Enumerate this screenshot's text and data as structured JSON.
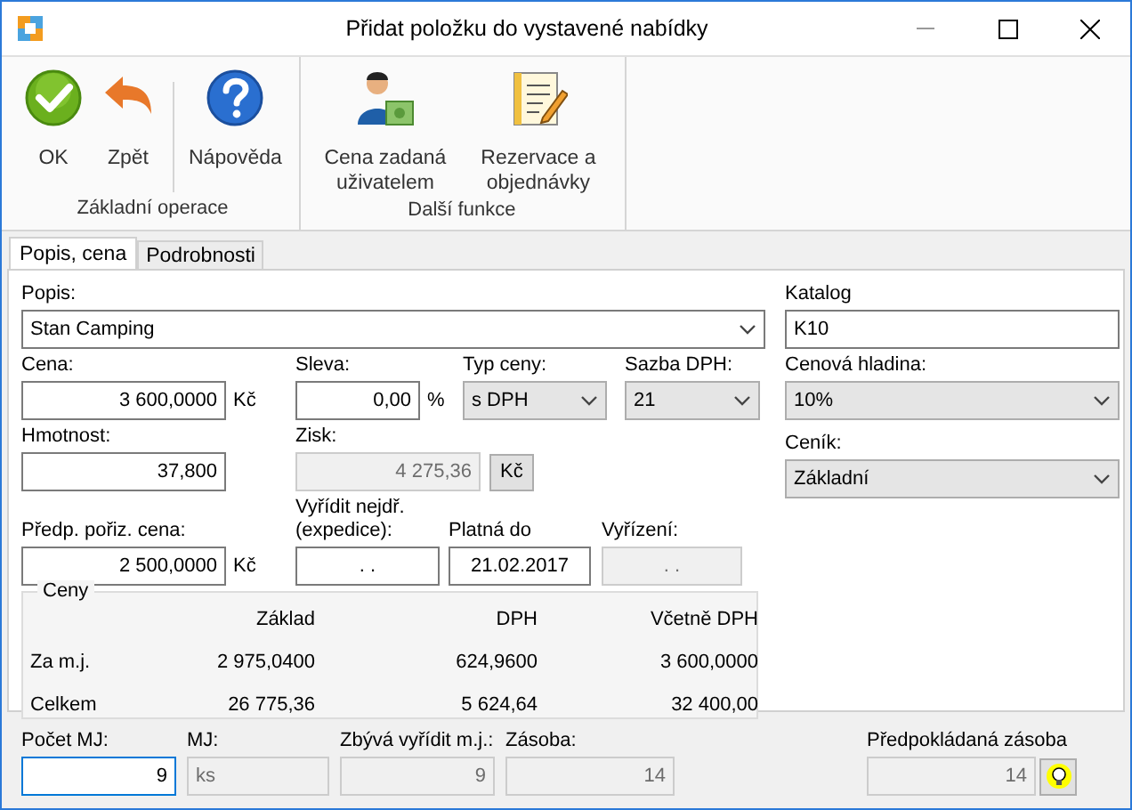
{
  "window": {
    "title": "Přidat položku do vystavené nabídky"
  },
  "ribbon": {
    "groups": [
      {
        "label": "Základní operace",
        "sections": [
          [
            {
              "label": "OK"
            },
            {
              "label": "Zpět"
            }
          ],
          [
            {
              "label": "Nápověda"
            }
          ]
        ]
      },
      {
        "label": "Další funkce",
        "sections": [
          [
            {
              "label": "Cena zadaná uživatelem"
            },
            {
              "label": "Rezervace a objednávky"
            }
          ]
        ]
      }
    ]
  },
  "tabs": [
    {
      "label": "Popis, cena",
      "selected": true
    },
    {
      "label": "Podrobnosti",
      "selected": false
    }
  ],
  "form": {
    "popis": {
      "label": "Popis:",
      "value": "Stan Camping",
      "kind": "combo",
      "disabled": false
    },
    "cena": {
      "label": "Cena:",
      "value": "3 600,0000",
      "kind": "number",
      "unit": "Kč",
      "disabled": false
    },
    "sleva": {
      "label": "Sleva:",
      "value": "0,00",
      "kind": "number",
      "unit": "%",
      "disabled": false
    },
    "typ_ceny": {
      "label": "Typ ceny:",
      "value": "s DPH",
      "kind": "select",
      "disabled": false
    },
    "sazba_dph": {
      "label": "Sazba DPH:",
      "value": "21",
      "kind": "select",
      "disabled": false
    },
    "hmotnost": {
      "label": "Hmotnost:",
      "value": "37,800",
      "kind": "number",
      "disabled": false
    },
    "zisk": {
      "label": "Zisk:",
      "value": "4 275,36",
      "kind": "number",
      "unit_button": "Kč",
      "disabled": true
    },
    "predp_poriz_cena": {
      "label": "Předp. pořiz. cena:",
      "value": "2 500,0000",
      "kind": "number",
      "unit": "Kč",
      "disabled": false
    },
    "vyridit_nejdr": {
      "label": "Vyřídit nejdř. (expedice):",
      "value": ".   .",
      "kind": "date",
      "disabled": false
    },
    "platna_do": {
      "label": "Platná do",
      "value": "21.02.2017",
      "kind": "date",
      "disabled": false
    },
    "vyrizeni": {
      "label": "Vyřízení:",
      "value": ".   .",
      "kind": "date",
      "disabled": true
    },
    "katalog": {
      "label": "Katalog",
      "value": "K10",
      "kind": "text",
      "disabled": false
    },
    "cenova_hladina": {
      "label": "Cenová hladina:",
      "value": "10%",
      "kind": "select",
      "disabled": false
    },
    "cenik": {
      "label": "Ceník:",
      "value": "Základní",
      "kind": "select",
      "disabled": false
    }
  },
  "prices": {
    "title": "Ceny",
    "columns": [
      "Základ",
      "DPH",
      "Včetně DPH"
    ],
    "rows": [
      {
        "label": "Za m.j.",
        "values": [
          "2 975,0400",
          "624,9600",
          "3 600,0000"
        ]
      },
      {
        "label": "Celkem",
        "values": [
          "26 775,36",
          "5 624,64",
          "32 400,00"
        ]
      }
    ]
  },
  "bottom": {
    "fields": [
      {
        "label": "Počet MJ:",
        "value": "9",
        "kind": "number",
        "disabled": false,
        "focused": true
      },
      {
        "label": "MJ:",
        "value": "ks",
        "kind": "text",
        "disabled": true,
        "focused": false
      },
      {
        "label": "Zbývá vyřídit m.j.:",
        "value": "9",
        "kind": "number",
        "disabled": true,
        "focused": false
      },
      {
        "label": "Zásoba:",
        "value": "14",
        "kind": "number",
        "disabled": true,
        "focused": false
      }
    ],
    "expected_stock": {
      "label": "Předpokládaná zásoba",
      "value": "14",
      "disabled": true
    }
  }
}
